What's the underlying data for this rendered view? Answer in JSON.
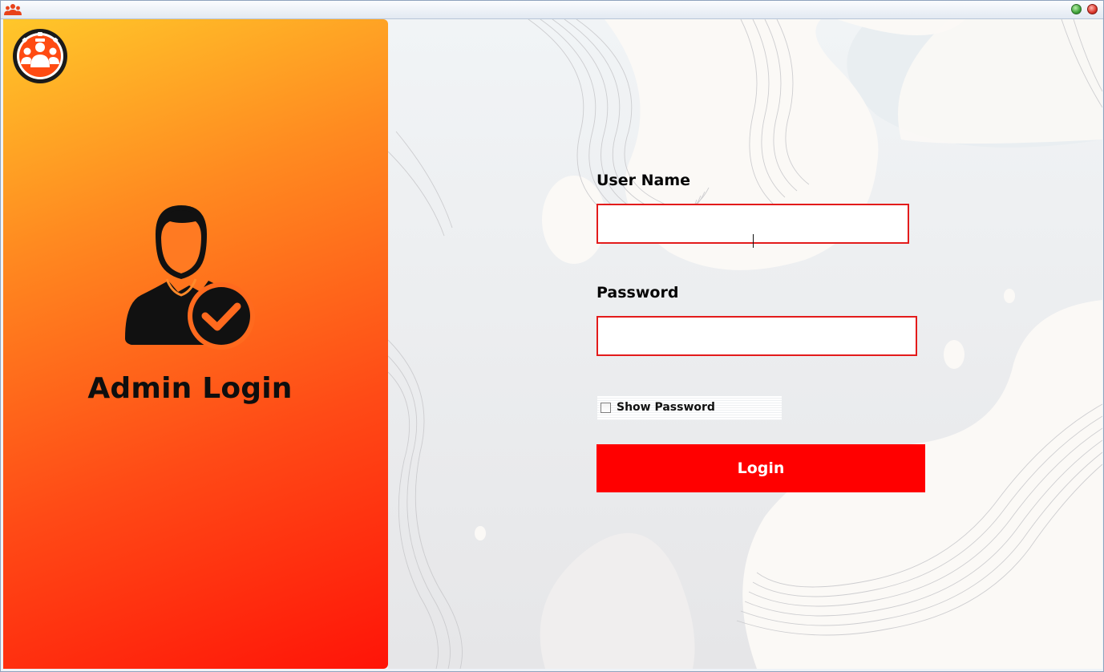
{
  "window": {
    "app_icon": "people-group-icon",
    "controls": [
      "maximize-button",
      "close-button"
    ]
  },
  "left_panel": {
    "logo_icon": "admin-team-logo-icon",
    "illustration_icon": "admin-user-check-icon",
    "title": "Admin Login"
  },
  "form": {
    "username_label": "User Name",
    "username_value": "",
    "password_label": "Password",
    "password_value": "",
    "show_password_label": "Show Password",
    "show_password_checked": false,
    "login_label": "Login"
  },
  "colors": {
    "accent_red": "#ff0000",
    "input_border": "#e31b1b",
    "gradient_top": "#ffc72a",
    "gradient_bottom": "#ff1408"
  }
}
